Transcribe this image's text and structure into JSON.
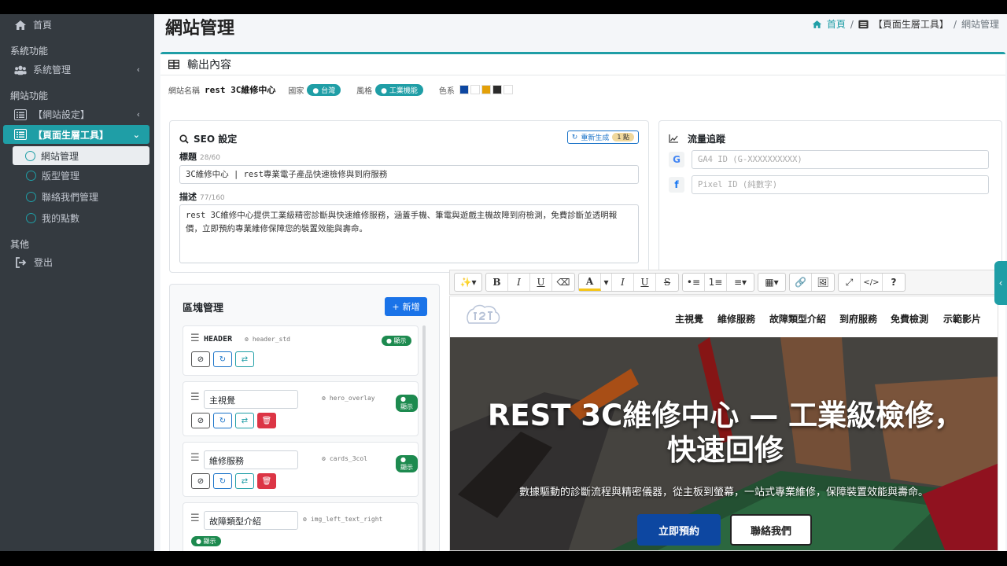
{
  "sidebar": {
    "home": "首頁",
    "section_system": "系統功能",
    "system_manage": "系統管理",
    "section_website": "網站功能",
    "website_settings": "【網站設定】",
    "page_builder": "【頁面生層工具】",
    "sub_items": [
      "網站管理",
      "版型管理",
      "聯絡我們管理",
      "我的點數"
    ],
    "section_other": "其他",
    "logout": "登出"
  },
  "header": {
    "title": "網站管理",
    "breadcrumb": [
      "首頁",
      "【頁面生層工具】",
      "網站管理"
    ]
  },
  "output": {
    "title": "輸出內容",
    "site_name_label": "網站名稱",
    "site_name": "rest 3C維修中心",
    "country_label": "國家",
    "country": "台灣",
    "style_label": "風格",
    "style": "工業機能",
    "palette_label": "色系",
    "palette": [
      "#0d47a1",
      "#ffffff",
      "#e3a008",
      "#2b2b2b",
      "#ffffff"
    ]
  },
  "seo": {
    "title": "SEO 設定",
    "regen_label": "重新生成",
    "regen_count": "1 點",
    "title_label": "標題",
    "title_count": "28/60",
    "title_value": "3C維修中心 | rest專業電子產品快速檢修與到府服務",
    "desc_label": "描述",
    "desc_count": "77/160",
    "desc_value": "rest 3C維修中心提供工業級精密診斷與快速維修服務，涵蓋手機、筆電與遊戲主機故障到府檢測，免費診斷並透明報價，立即預約專業維修保障您的裝置效能與壽命。"
  },
  "tracking": {
    "title": "流量追蹤",
    "ga_placeholder": "GA4 ID (G-XXXXXXXXXX)",
    "pixel_placeholder": "Pixel ID (純數字)"
  },
  "blocks": {
    "title": "區塊管理",
    "add_label": "新增",
    "show_label": "顯示",
    "items": [
      {
        "name": "HEADER",
        "type": "header_std"
      },
      {
        "name": "主視覺",
        "type": "hero_overlay"
      },
      {
        "name": "維修服務",
        "type": "cards_3col"
      },
      {
        "name": "故障類型介紹",
        "type": "img_left_text_right"
      }
    ]
  },
  "preview": {
    "nav": [
      "主視覺",
      "維修服務",
      "故障類型介紹",
      "到府服務",
      "免費檢測",
      "示範影片"
    ],
    "hero_title": "REST 3C維修中心 — 工業級檢修，快速回修",
    "hero_sub": "數據驅動的診斷流程與精密儀器，從主板到螢幕，一站式專業維修，保障裝置效能與壽命。",
    "btn_primary": "立即預約",
    "btn_secondary": "聯絡我們"
  },
  "colors": {
    "accent": "#1f9ea6",
    "primary": "#1a73c8",
    "sidebar": "#343a40",
    "hero_btn": "#0d47a1"
  }
}
